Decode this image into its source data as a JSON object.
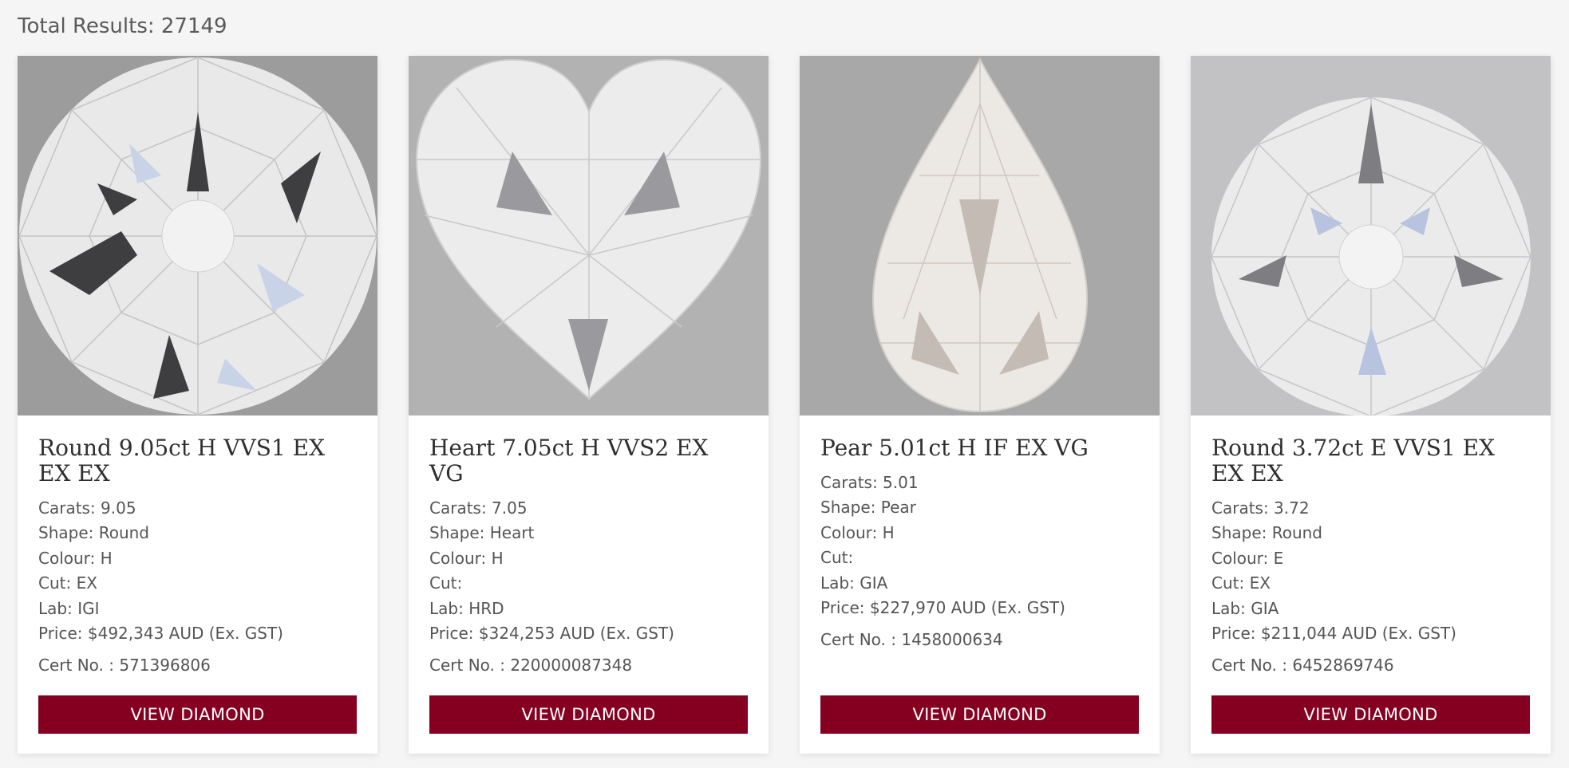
{
  "results": {
    "label": "Total Results: 27149"
  },
  "cards": [
    {
      "title": "Round 9.05ct H VVS1 EX EX EX",
      "carats": "Carats: 9.05",
      "shape": "Shape: Round",
      "colour": "Colour: H",
      "cut": "Cut: EX",
      "lab": "Lab: IGI",
      "price": "Price: $492,343 AUD (Ex. GST)",
      "cert": "Cert No. : 571396806",
      "button": "VIEW DIAMOND",
      "image_icon": "round-diamond-icon"
    },
    {
      "title": "Heart 7.05ct H VVS2 EX VG",
      "carats": "Carats: 7.05",
      "shape": "Shape: Heart",
      "colour": "Colour: H",
      "cut": "Cut:",
      "lab": "Lab: HRD",
      "price": "Price: $324,253 AUD (Ex. GST)",
      "cert": "Cert No. : 220000087348",
      "button": "VIEW DIAMOND",
      "image_icon": "heart-diamond-icon"
    },
    {
      "title": "Pear 5.01ct H IF EX VG",
      "carats": "Carats: 5.01",
      "shape": "Shape: Pear",
      "colour": "Colour: H",
      "cut": "Cut:",
      "lab": "Lab: GIA",
      "price": "Price: $227,970 AUD (Ex. GST)",
      "cert": "Cert No. : 1458000634",
      "button": "VIEW DIAMOND",
      "image_icon": "pear-diamond-icon"
    },
    {
      "title": "Round 3.72ct E VVS1 EX EX EX",
      "carats": "Carats: 3.72",
      "shape": "Shape: Round",
      "colour": "Colour: E",
      "cut": "Cut: EX",
      "lab": "Lab: GIA",
      "price": "Price: $211,044 AUD (Ex. GST)",
      "cert": "Cert No. : 6452869746",
      "button": "VIEW DIAMOND",
      "image_icon": "round-diamond-icon"
    }
  ],
  "colors": {
    "accent": "#850020",
    "background": "#f5f5f5",
    "card": "#ffffff"
  }
}
